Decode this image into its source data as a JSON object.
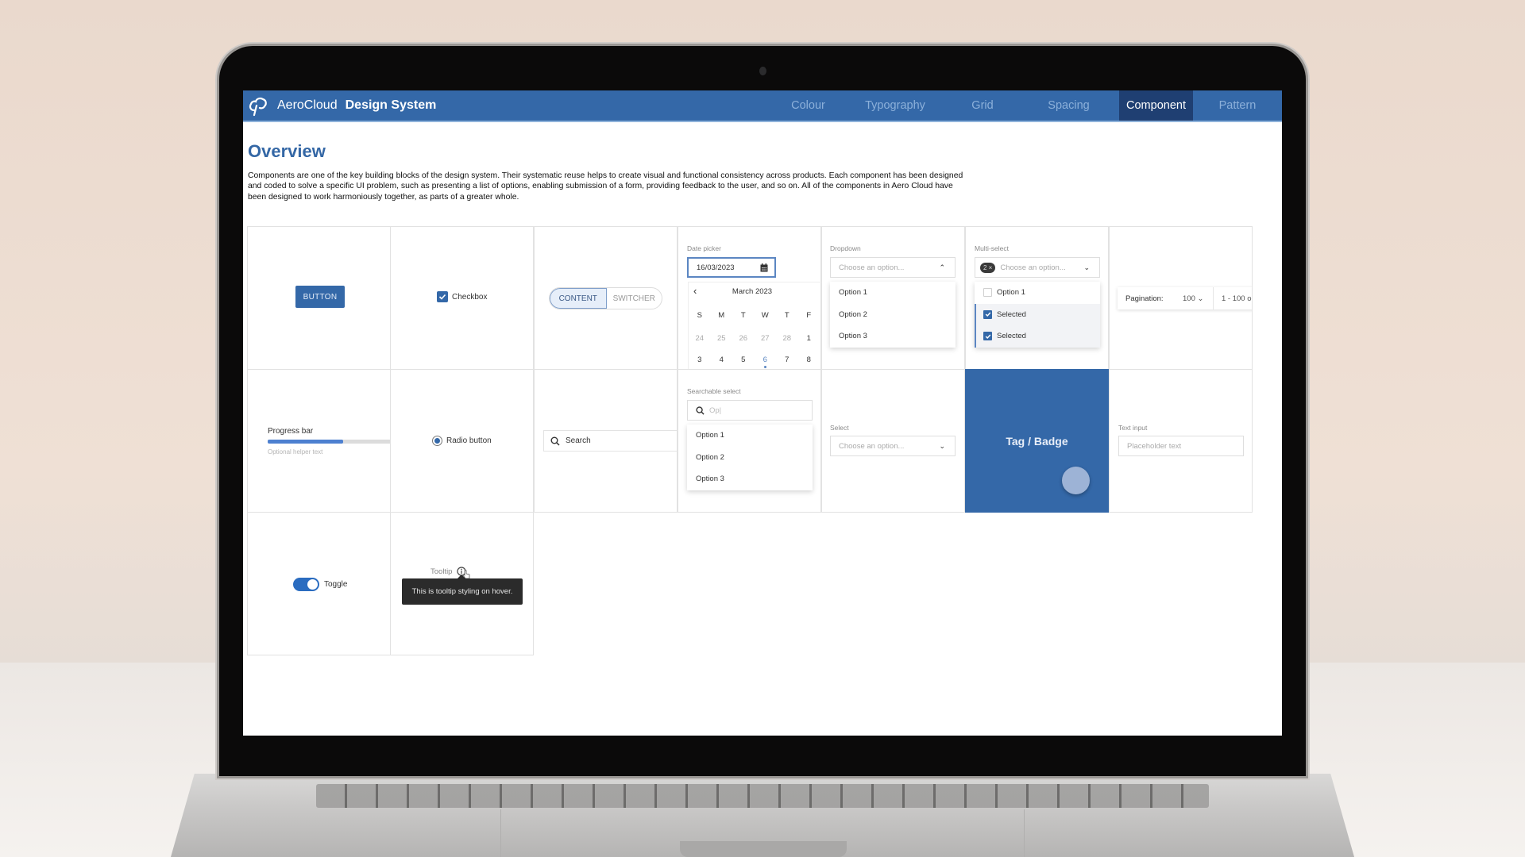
{
  "app": {
    "brand_name": "AeroCloud",
    "brand_title": "Design System",
    "accent_color": "#3468a8",
    "active_nav_color": "#1f3f72"
  },
  "nav": {
    "items": [
      {
        "label": "Colour",
        "active": false
      },
      {
        "label": "Typography",
        "active": false
      },
      {
        "label": "Grid",
        "active": false
      },
      {
        "label": "Spacing",
        "active": false
      },
      {
        "label": "Component",
        "active": true
      },
      {
        "label": "Pattern",
        "active": false
      }
    ]
  },
  "page": {
    "title": "Overview",
    "intro": "Components are one of the key building blocks of the design system. Their systematic reuse helps to create visual and functional consistency across products. Each component has been designed and coded to solve a specific UI problem, such as presenting a list of options, enabling submission of a form, providing feedback to the user, and so on. All of the components in Aero Cloud have been designed to work harmoniously together, as parts of a greater whole."
  },
  "components": {
    "button": {
      "label": "BUTTON"
    },
    "checkbox": {
      "label": "Checkbox",
      "checked": true
    },
    "switcher": {
      "options": [
        "CONTENT",
        "SWITCHER"
      ],
      "selected": "CONTENT"
    },
    "date_picker": {
      "label": "Date picker",
      "value": "16/03/2023",
      "month": "March 2023",
      "weekdays": [
        "S",
        "M",
        "T",
        "W",
        "T",
        "F"
      ],
      "rows": [
        [
          "24",
          "25",
          "26",
          "27",
          "28",
          "1"
        ],
        [
          "3",
          "4",
          "5",
          "6",
          "7",
          "8"
        ]
      ],
      "today": "6"
    },
    "dropdown": {
      "label": "Dropdown",
      "placeholder": "Choose an option...",
      "options": [
        "Option 1",
        "Option 2",
        "Option 3"
      ]
    },
    "multi_select": {
      "label": "Multi-select",
      "count_badge": "2 ×",
      "placeholder": "Choose an option...",
      "options": [
        {
          "label": "Option 1",
          "checked": false
        },
        {
          "label": "Selected",
          "checked": true
        },
        {
          "label": "Selected",
          "checked": true
        }
      ]
    },
    "pagination": {
      "label": "Pagination:",
      "page_size": "100",
      "range": "1 - 100 o"
    },
    "progress_bar": {
      "label": "Progress bar",
      "helper": "Optional helper text",
      "progress_percent": 61
    },
    "radio": {
      "label": "Radio button",
      "selected": true
    },
    "search": {
      "placeholder": "Search"
    },
    "searchable_select": {
      "label": "Searchable select",
      "query": "Op|",
      "options": [
        "Option 1",
        "Option 2",
        "Option 3"
      ]
    },
    "select": {
      "label": "Select",
      "placeholder": "Choose an option..."
    },
    "tag_badge": {
      "label": "Tag / Badge"
    },
    "text_input": {
      "label": "Text input",
      "placeholder": "Placeholder text"
    },
    "toggle": {
      "label": "Toggle",
      "on": true
    },
    "tooltip": {
      "label": "Tooltip",
      "text": "This is tooltip styling on hover."
    }
  }
}
